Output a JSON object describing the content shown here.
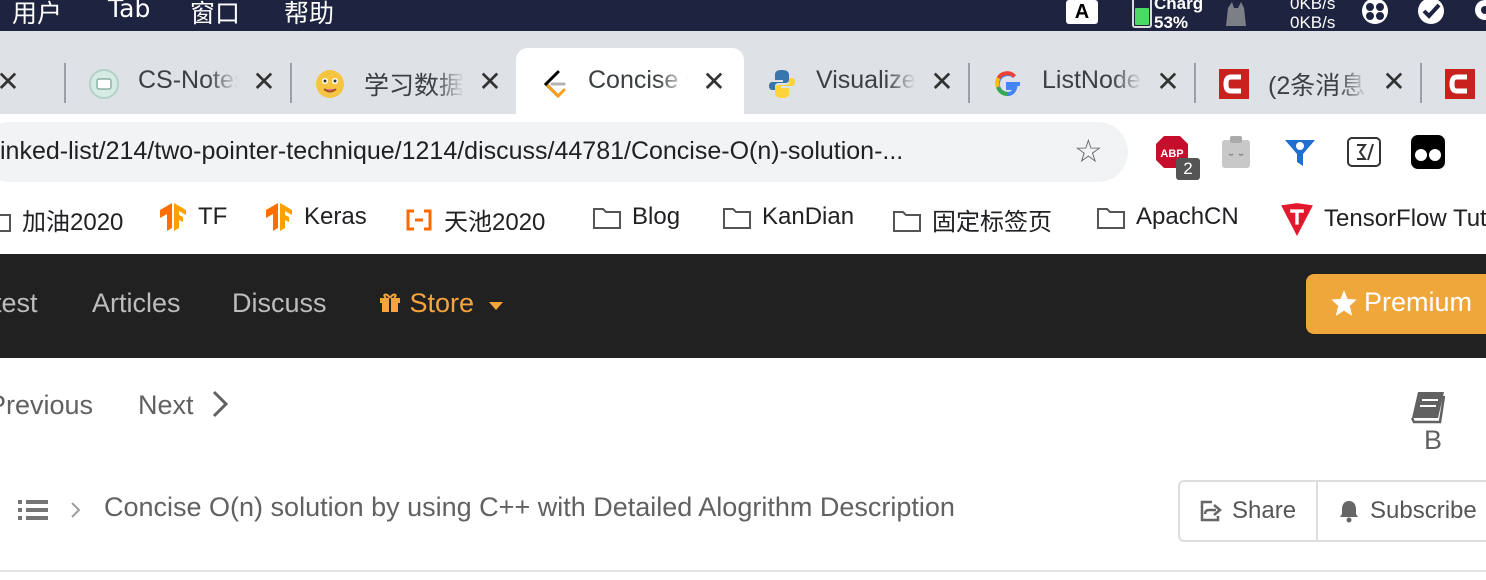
{
  "menubar": {
    "items": [
      "用户",
      "Tab",
      "窗口",
      "帮助"
    ],
    "input_source": "A",
    "battery_label": "Charg",
    "battery_percent": "53%",
    "net_up": "0KB/s",
    "net_down": "0KB/s"
  },
  "tabs": [
    {
      "title": "CS-Notes",
      "icon": "cs-notes-icon"
    },
    {
      "title": "学习数据结构",
      "icon": "emoji-icon"
    },
    {
      "title": "Concise O(n)",
      "icon": "leetcode-icon",
      "active": true
    },
    {
      "title": "Visualize",
      "icon": "python-icon"
    },
    {
      "title": "ListNode",
      "icon": "google-icon"
    },
    {
      "title": "(2条消息",
      "icon": "csdn-icon"
    }
  ],
  "address": {
    "url": "inked-list/214/two-pointer-technique/1214/discuss/44781/Concise-O(n)-solution-..."
  },
  "extensions": {
    "abp_badge": "2"
  },
  "bookmarks": [
    {
      "label": "加油2020",
      "icon": "folder-icon"
    },
    {
      "label": "TF",
      "icon": "tensorflow-icon"
    },
    {
      "label": "Keras",
      "icon": "tensorflow-icon"
    },
    {
      "label": "天池2020",
      "icon": "aliyun-icon"
    },
    {
      "label": "Blog",
      "icon": "folder-icon"
    },
    {
      "label": "KanDian",
      "icon": "folder-icon"
    },
    {
      "label": "固定标签页",
      "icon": "folder-icon"
    },
    {
      "label": "ApachCN",
      "icon": "folder-icon"
    },
    {
      "label": "TensorFlow Tut",
      "icon": "tensorflow-red-icon"
    }
  ],
  "nav": {
    "contest": "test",
    "articles": "Articles",
    "discuss": "Discuss",
    "store": "Store",
    "premium": "Premium"
  },
  "content": {
    "previous": "Previous",
    "next": "Next",
    "guide": "B",
    "topic_title": "Concise O(n) solution by using C++ with Detailed Alogrithm Description",
    "share": "Share",
    "subscribe": "Subscribe"
  },
  "colors": {
    "menubar": "#1e2440",
    "nav_bg": "#212121",
    "store": "#f6a43b",
    "premium": "#efa63a"
  }
}
